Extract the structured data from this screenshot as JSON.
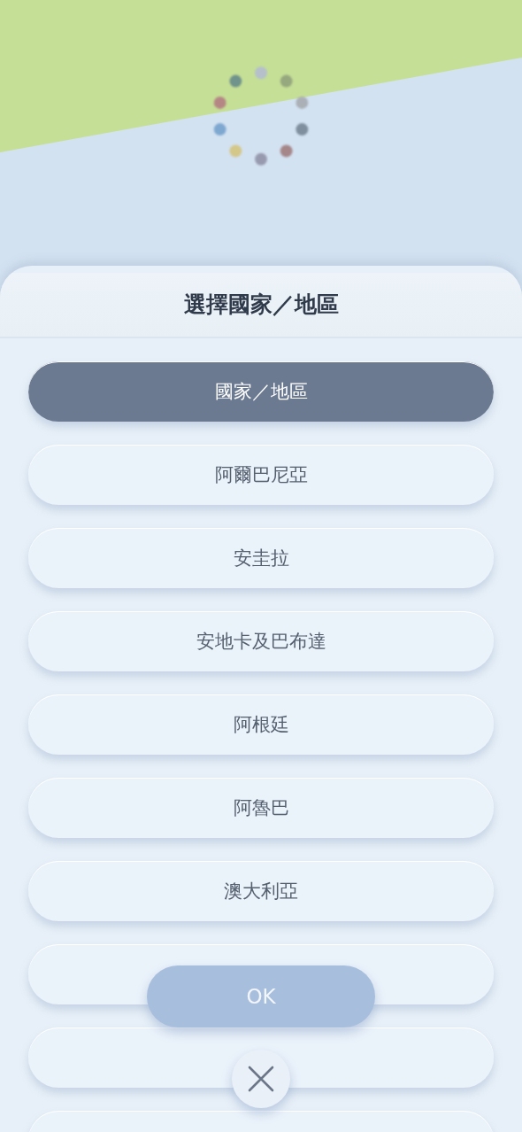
{
  "sheet": {
    "title": "選擇國家／地區"
  },
  "items": [
    {
      "label": "國家／地區",
      "selected": true
    },
    {
      "label": "阿爾巴尼亞",
      "selected": false
    },
    {
      "label": "安圭拉",
      "selected": false
    },
    {
      "label": "安地卡及巴布達",
      "selected": false
    },
    {
      "label": "阿根廷",
      "selected": false
    },
    {
      "label": "阿魯巴",
      "selected": false
    },
    {
      "label": "澳大利亞",
      "selected": false
    },
    {
      "selected": false
    },
    {
      "selected": false
    },
    {
      "selected": false
    }
  ],
  "ok_button": {
    "label": "OK"
  }
}
